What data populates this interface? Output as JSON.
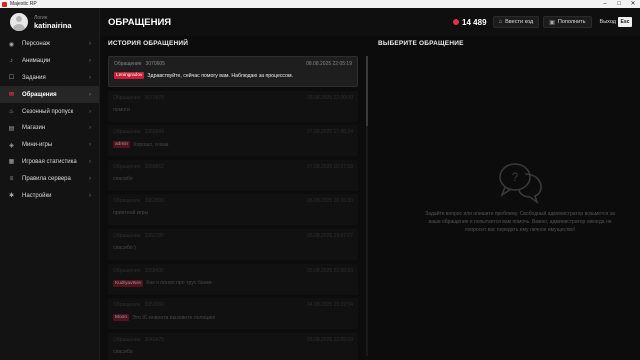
{
  "window": {
    "title": "Majestic RP",
    "buttons": [
      "–",
      "□",
      "✕"
    ]
  },
  "profile": {
    "login_label": "Логин",
    "username": "katinairina"
  },
  "sidebar": {
    "items": [
      {
        "label": "Персонаж",
        "icon": "person-icon"
      },
      {
        "label": "Анимации",
        "icon": "animation-icon"
      },
      {
        "label": "Задания",
        "icon": "tasks-icon"
      },
      {
        "label": "Обращения",
        "icon": "tickets-icon",
        "active": true
      },
      {
        "label": "Сезонный пропуск",
        "icon": "fire-icon"
      },
      {
        "label": "Магазин",
        "icon": "shop-icon"
      },
      {
        "label": "Мини-игры",
        "icon": "gamepad-icon"
      },
      {
        "label": "Игровая статистика",
        "icon": "stats-icon"
      },
      {
        "label": "Правила сервера",
        "icon": "rules-icon"
      },
      {
        "label": "Настройки",
        "icon": "gear-icon"
      }
    ]
  },
  "topbar": {
    "title": "ОБРАЩЕНИЯ",
    "balance": "14 489",
    "promo_button": "Ввести код",
    "topup_button": "Пополнить",
    "exit_label": "Выход",
    "exit_key": "Esc"
  },
  "history": {
    "title": "ИСТОРИЯ ОБРАЩЕНИЙ",
    "tickets": [
      {
        "label": "Обращение",
        "id": "3070605",
        "date": "08.08.2025 22:05:19",
        "tag": "Leningradov",
        "message": "Здравствуйте, сейчас помогу вам. Наблюдаю за процессом."
      },
      {
        "label": "Обращение",
        "id": "3070570",
        "date": "08.08.2025 22:00:00",
        "tag": "",
        "message": "помоги"
      },
      {
        "label": "Обращение",
        "id": "3069244",
        "date": "07.08.2025 17:45:34",
        "tag": "admin",
        "message": "Хорошо, я вам"
      },
      {
        "label": "Обращение",
        "id": "3068852",
        "date": "07.08.2025 10:37:58",
        "tag": "",
        "message": "спасибо"
      },
      {
        "label": "Обращение",
        "id": "3062893",
        "date": "06.08.2025 20:26:30",
        "tag": "",
        "message": "приятной игры"
      },
      {
        "label": "Обращение",
        "id": "3060780",
        "date": "05.08.2025 23:07:07",
        "tag": "",
        "message": "спасибо:)"
      },
      {
        "label": "Обращение",
        "id": "3058430",
        "date": "05.08.2025 22:59:53",
        "tag": "Kudryavtsev",
        "message": "Как я понял про трус банки"
      },
      {
        "label": "Обращение",
        "id": "3053060",
        "date": "04.08.2025 20:22:04",
        "tag": "Moon",
        "message": "Это IC инвента вызовите полицию"
      },
      {
        "label": "Обращение",
        "id": "3049475",
        "date": "03.08.2025 22:09:00",
        "tag": "",
        "message": "спасибо"
      }
    ]
  },
  "details": {
    "title": "ВЫБЕРИТЕ ОБРАЩЕНИЕ",
    "placeholder": "Задайте вопрос или опишите проблему. Свободный администратор возьмется за ваше обращение и попытается вам помочь. Важно, администратор никогда не попросит вас передать ему личное имущество!"
  },
  "colors": {
    "accent": "#e0304a",
    "background": "#0c0c0c",
    "panel": "#161616"
  }
}
